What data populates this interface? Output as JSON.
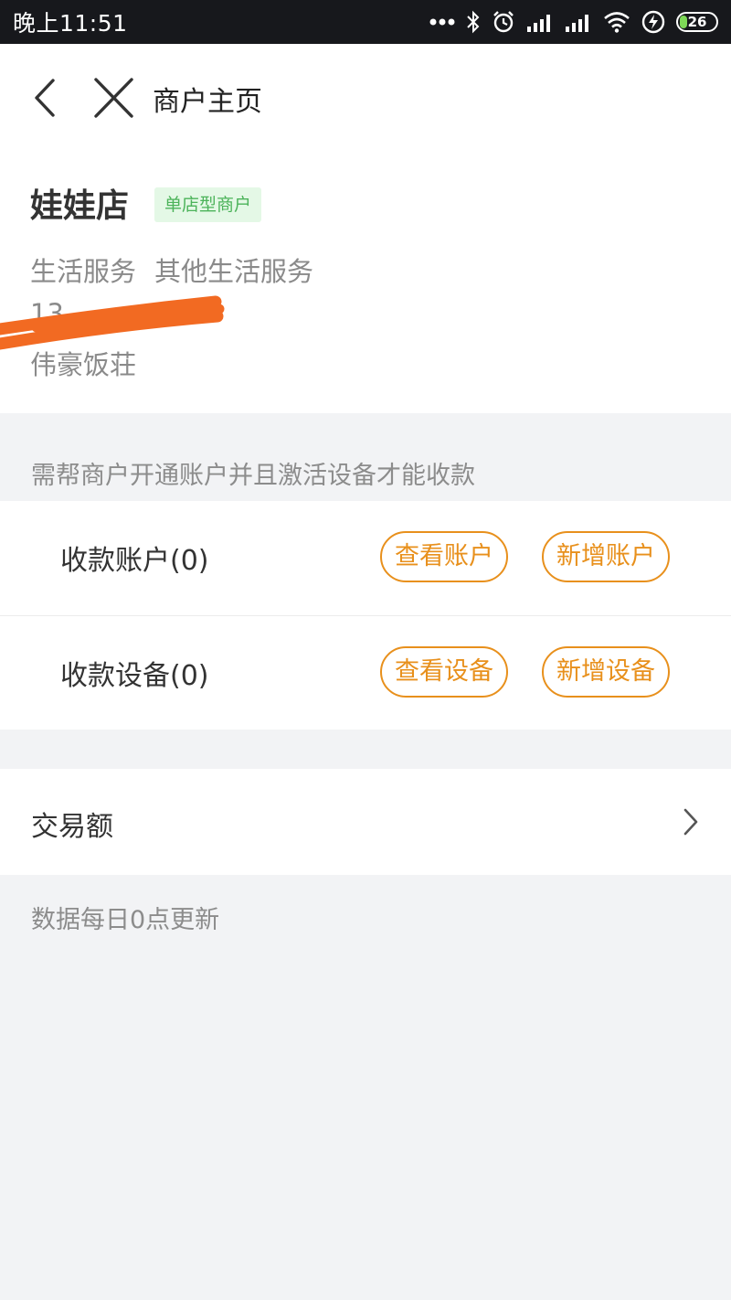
{
  "status_bar": {
    "time": "晚上11:51",
    "battery": "26",
    "icons": [
      "more-dots-icon",
      "bluetooth-icon",
      "alarm-icon",
      "signal-icon",
      "signal-icon",
      "wifi-icon",
      "charging-icon",
      "battery-icon"
    ]
  },
  "nav": {
    "title": "商户主页",
    "back_icon": "back-icon",
    "close_icon": "close-icon"
  },
  "merchant": {
    "name": "娃娃店",
    "tag": "单店型商户",
    "category": "生活服务",
    "subcategory": "其他生活服务",
    "phone_partial": "13",
    "owner": "伟豪饭荘"
  },
  "notice": "需帮商户开通账户并且激活设备才能收款",
  "payment": {
    "account": {
      "label": "收款账户(0)",
      "view_button": "查看账户",
      "add_button": "新增账户"
    },
    "device": {
      "label": "收款设备(0)",
      "view_button": "查看设备",
      "add_button": "新增设备"
    }
  },
  "trade": {
    "label": "交易额",
    "note": "数据每日0点更新"
  },
  "colors": {
    "accent": "#e8901c",
    "tag_bg": "#e4f8e6",
    "tag_text": "#4cb35a",
    "redaction": "#f26a22"
  }
}
